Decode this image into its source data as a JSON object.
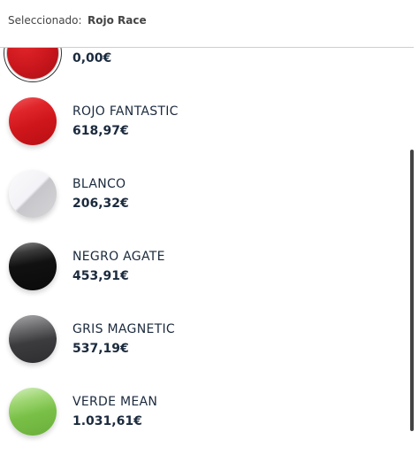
{
  "header": {
    "label": "Seleccionado:",
    "selected": "Rojo Race"
  },
  "colors": [
    {
      "name": "",
      "price": "0,00€",
      "hex": "#c8161c",
      "selected": true
    },
    {
      "name": "ROJO FANTASTIC",
      "price": "618,97€",
      "hex": "#d31a1f",
      "selected": false
    },
    {
      "name": "BLANCO",
      "price": "206,32€",
      "hex": "#e9e9ec",
      "selected": false
    },
    {
      "name": "NEGRO AGATE",
      "price": "453,91€",
      "hex": "#121212",
      "selected": false
    },
    {
      "name": "GRIS MAGNETIC",
      "price": "537,19€",
      "hex": "#3a3a3c",
      "selected": false
    },
    {
      "name": "VERDE MEAN",
      "price": "1.031,61€",
      "hex": "#7cc24a",
      "selected": false
    }
  ]
}
